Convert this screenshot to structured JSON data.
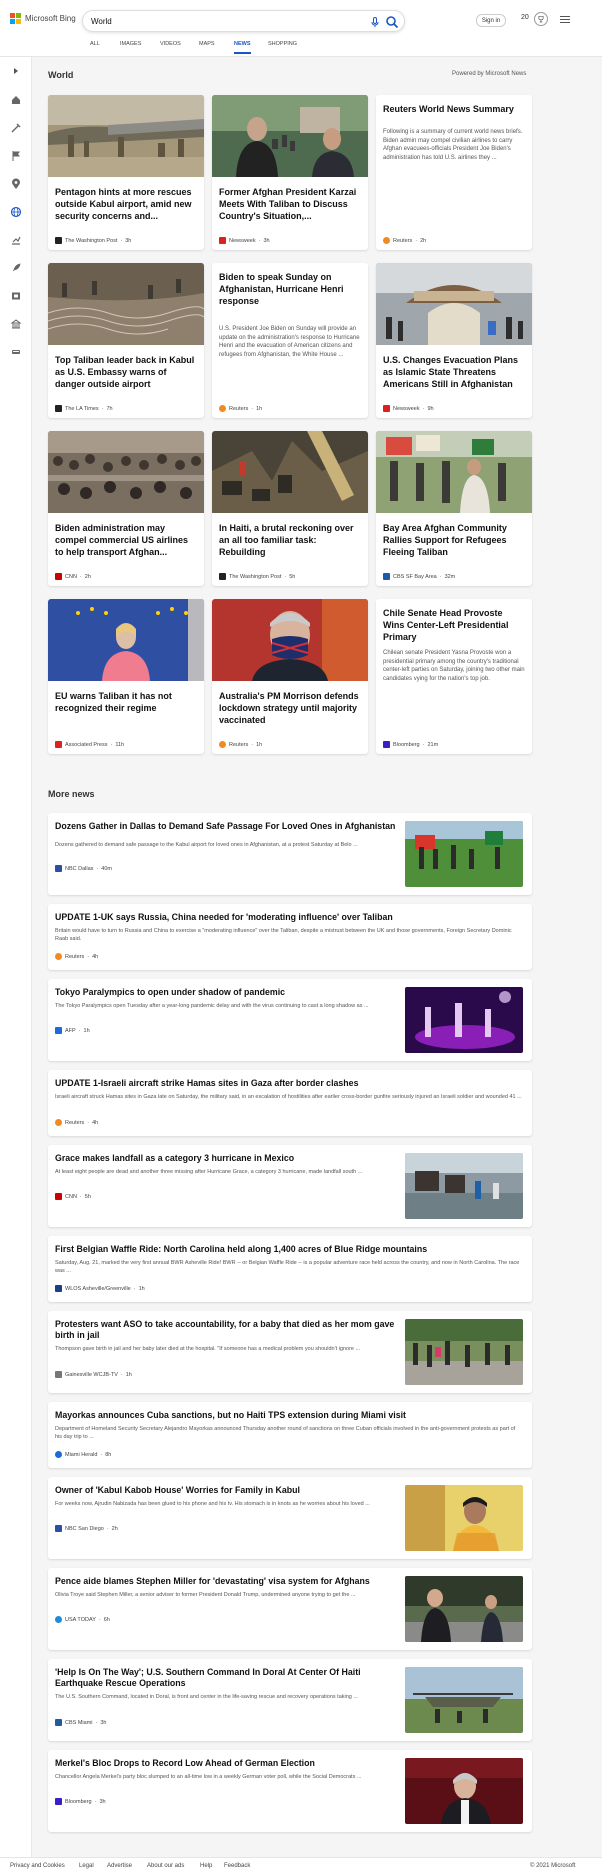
{
  "header": {
    "brand": "Microsoft Bing",
    "search_value": "World",
    "sign_in": "Sign in",
    "rewards_count": "20"
  },
  "tabs": [
    "ALL",
    "IMAGES",
    "VIDEOS",
    "MAPS",
    "NEWS",
    "SHOPPING"
  ],
  "active_tab": "NEWS",
  "section": {
    "title": "World",
    "powered": "Powered by Microsoft News"
  },
  "cards": [
    {
      "title": "Pentagon hints at more rescues outside Kabul airport, amid new security concerns and...",
      "snippet": "",
      "source": "The Washington Post",
      "time": "3h"
    },
    {
      "title": "Former Afghan President Karzai Meets With Taliban to Discuss Country's Situation,...",
      "snippet": "",
      "source": "Newsweek",
      "time": "3h"
    },
    {
      "title": "Reuters World News Summary",
      "snippet": "Following is a summary of current world news briefs. Biden admin may compel civilian airlines to carry Afghan evacuees-officials President Joe Biden's administration has told U.S. airlines they ...",
      "source": "Reuters",
      "time": "2h"
    },
    {
      "title": "Top Taliban leader back in Kabul as U.S. Embassy warns of danger outside airport",
      "snippet": "",
      "source": "The LA Times",
      "time": "7h"
    },
    {
      "title": "Biden to speak Sunday on Afghanistan, Hurricane Henri response",
      "snippet": "U.S. President Joe Biden on Sunday will provide an update on the administration's response to Hurricane Henri and the evacuation of American citizens and refugees from Afghanistan, the White House ...",
      "source": "Reuters",
      "time": "1h"
    },
    {
      "title": "U.S. Changes Evacuation Plans as Islamic State Threatens Americans Still in Afghanistan",
      "snippet": "",
      "source": "Newsweek",
      "time": "9h"
    },
    {
      "title": "Biden administration may compel commercial US airlines to help transport Afghan...",
      "snippet": "",
      "source": "CNN",
      "time": "2h"
    },
    {
      "title": "In Haiti, a brutal reckoning over an all too familiar task: Rebuilding",
      "snippet": "",
      "source": "The Washington Post",
      "time": "5h"
    },
    {
      "title": "Bay Area Afghan Community Rallies Support for Refugees Fleeing Taliban",
      "snippet": "",
      "source": "CBS SF Bay Area",
      "time": "32m"
    },
    {
      "title": "EU warns Taliban it has not recognized their regime",
      "snippet": "",
      "source": "Associated Press",
      "time": "11h"
    },
    {
      "title": "Australia's PM Morrison defends lockdown strategy until majority vaccinated",
      "snippet": "",
      "source": "Reuters",
      "time": "1h"
    },
    {
      "title": "Chile Senate Head Provoste Wins Center-Left Presidential Primary",
      "snippet": "Chilean senate President Yasna Provoste won a presidential primary among the country's traditional center-left parties on Saturday, joining two other main candidates vying for the nation's top job.",
      "source": "Bloomberg",
      "time": "21m"
    }
  ],
  "more_title": "More news",
  "more": [
    {
      "title": "Dozens Gather in Dallas to Demand Safe Passage For Loved Ones in Afghanistan",
      "snippet": "Dozens gathered to demand safe passage to the Kabul airport for loved ones in Afghanistan, at a protest Saturday at Belo ...",
      "source": "NBC Dallas",
      "time": "40m"
    },
    {
      "title": "UPDATE 1-UK says Russia, China needed for 'moderating influence' over Taliban",
      "snippet": "Britain would have to turn to Russia and China to exercise a \"moderating influence\" over the Taliban, despite a mistrust between the UK and those governments, Foreign Secretary Dominic Raab said.",
      "source": "Reuters",
      "time": "4h"
    },
    {
      "title": "Tokyo Paralympics to open under shadow of pandemic",
      "snippet": "The Tokyo Paralympics open Tuesday after a year-long pandemic delay and with the virus continuing to cast a long shadow as ...",
      "source": "AFP",
      "time": "1h"
    },
    {
      "title": "UPDATE 1-Israeli aircraft strike Hamas sites in Gaza after border clashes",
      "snippet": "Israeli aircraft struck Hamas sites in Gaza late on Saturday, the military said, in an escalation of hostilities after earlier cross-border gunfire seriously injured an Israeli soldier and wounded 41 ...",
      "source": "Reuters",
      "time": "4h"
    },
    {
      "title": "Grace makes landfall as a category 3 hurricane in Mexico",
      "snippet": "At least eight people are dead and another three missing after Hurricane Grace, a category 3 hurricane, made landfall south ...",
      "source": "CNN",
      "time": "5h"
    },
    {
      "title": "First Belgian Waffle Ride: North Carolina held along 1,400 acres of Blue Ridge mountains",
      "snippet": "Saturday, Aug. 21, marked the very first annual BWR Asheville Ride! BWR -- or Belgian Waffle Ride -- is a popular adventure race held across the country, and now in North Carolina. The race was ...",
      "source": "WLOS Asheville/Greenville",
      "time": "1h"
    },
    {
      "title": "Protesters want ASO to take accountability, for a baby that died as her mom gave birth in jail",
      "snippet": "Thompson gave birth in jail and her baby later died at the hospital. \"If someone has a medical problem you shouldn't ignore ...",
      "source": "Gainesville WCJB-TV",
      "time": "1h"
    },
    {
      "title": "Mayorkas announces Cuba sanctions, but no Haiti TPS extension during Miami visit",
      "snippet": "Department of Homeland Security Secretary Alejandro Mayorkas announced Thursday another round of sanctions on three Cuban officials involved in the anti-government protests as part of his day trip to ...",
      "source": "Miami Herald",
      "time": "8h"
    },
    {
      "title": "Owner of 'Kabul Kabob House' Worries for Family in Kabul",
      "snippet": "For weeks now, Ajrudin Nabizada has been glued to his phone and his tv. His stomach is in knots as he worries about his loved ...",
      "source": "NBC San Diego",
      "time": "2h"
    },
    {
      "title": "Pence aide blames Stephen Miller for 'devastating' visa system for Afghans",
      "snippet": "Olivia Troye said Stephen Miller, a senior adviser to former President Donald Trump, undermined anyone trying to get the ...",
      "source": "USA TODAY",
      "time": "6h"
    },
    {
      "title": "'Help Is On The Way'; U.S. Southern Command In Doral At Center Of Haiti Earthquake Rescue Operations",
      "snippet": "The U.S. Southern Command, located in Doral, is front and center in the life-saving rescue and recovery operations taking ...",
      "source": "CBS Miami",
      "time": "3h"
    },
    {
      "title": "Merkel's Bloc Drops to Record Low Ahead of German Election",
      "snippet": "Chancellor Angela Merkel's party bloc slumped to an all-time low in a weekly German voter poll, while the Social Democrats ...",
      "source": "Bloomberg",
      "time": "3h"
    }
  ],
  "footer": {
    "links": [
      "Privacy and Cookies",
      "Legal",
      "Advertise",
      "About our ads",
      "Help",
      "Feedback"
    ],
    "copyright": "© 2021 Microsoft"
  },
  "colors": {
    "accent": "#1a56c4",
    "logo": [
      "#f25022",
      "#7fba00",
      "#00a4ef",
      "#ffb900"
    ]
  },
  "icons": [
    "chevron-right-icon",
    "home-icon",
    "tools-icon",
    "flag-icon",
    "location-icon",
    "globe-icon",
    "chart-icon",
    "rocket-icon",
    "film-icon",
    "building-icon",
    "car-icon",
    "mic-icon",
    "search-icon",
    "trophy-icon",
    "menu-icon"
  ]
}
